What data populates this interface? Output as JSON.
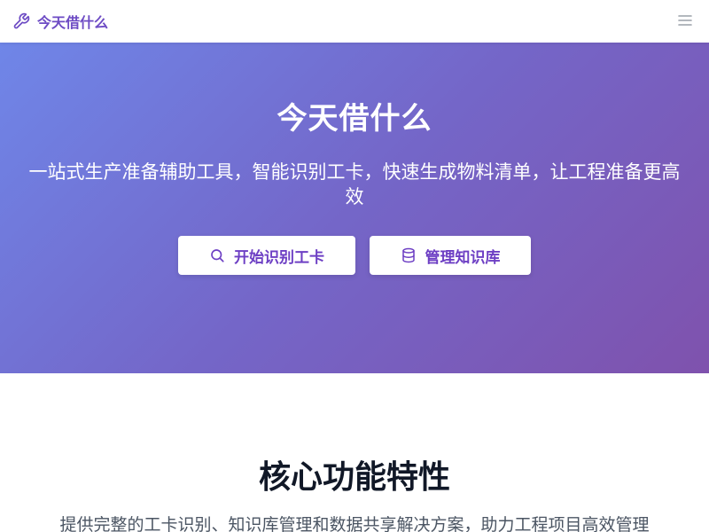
{
  "navbar": {
    "brand_icon": "wrench-icon",
    "brand_text": "今天借什么",
    "menu_icon": "hamburger-menu-icon"
  },
  "hero": {
    "title": "今天借什么",
    "subtitle": "一站式生产准备辅助工具，智能识别工卡，快速生成物料清单，让工程准备更高效",
    "buttons": [
      {
        "label": "开始识别工卡",
        "icon": "search-icon"
      },
      {
        "label": "管理知识库",
        "icon": "database-icon"
      }
    ]
  },
  "features": {
    "title": "核心功能特性",
    "subtitle": "提供完整的工卡识别、知识库管理和数据共享解决方案，助力工程项目高效管理"
  },
  "colors": {
    "brand": "#6d4bc4",
    "gradient_start": "#6f86e8",
    "gradient_end": "#7f52ad",
    "button_text": "#6d3fc4"
  }
}
